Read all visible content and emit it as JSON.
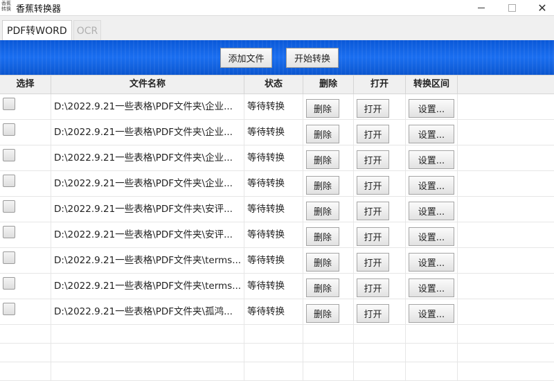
{
  "window": {
    "title": "香蕉转换器",
    "icon_text": "香蕉转换"
  },
  "tabs": [
    {
      "label": "PDF转WORD",
      "active": true
    },
    {
      "label": "OCR",
      "active": false
    }
  ],
  "toolbar": {
    "add_label": "添加文件",
    "start_label": "开始转换"
  },
  "table": {
    "headers": [
      "选择",
      "文件名称",
      "状态",
      "删除",
      "打开",
      "转换区间"
    ],
    "rows": [
      {
        "file": "D:\\2022.9.21一些表格\\PDF文件夹\\企业...",
        "status": "等待转换",
        "delete": "删除",
        "open": "打开",
        "range": "设置..."
      },
      {
        "file": "D:\\2022.9.21一些表格\\PDF文件夹\\企业...",
        "status": "等待转换",
        "delete": "删除",
        "open": "打开",
        "range": "设置..."
      },
      {
        "file": "D:\\2022.9.21一些表格\\PDF文件夹\\企业...",
        "status": "等待转换",
        "delete": "删除",
        "open": "打开",
        "range": "设置..."
      },
      {
        "file": "D:\\2022.9.21一些表格\\PDF文件夹\\企业...",
        "status": "等待转换",
        "delete": "删除",
        "open": "打开",
        "range": "设置..."
      },
      {
        "file": "D:\\2022.9.21一些表格\\PDF文件夹\\安评...",
        "status": "等待转换",
        "delete": "删除",
        "open": "打开",
        "range": "设置..."
      },
      {
        "file": "D:\\2022.9.21一些表格\\PDF文件夹\\安评...",
        "status": "等待转换",
        "delete": "删除",
        "open": "打开",
        "range": "设置..."
      },
      {
        "file": "D:\\2022.9.21一些表格\\PDF文件夹\\terms...",
        "status": "等待转换",
        "delete": "删除",
        "open": "打开",
        "range": "设置..."
      },
      {
        "file": "D:\\2022.9.21一些表格\\PDF文件夹\\terms...",
        "status": "等待转换",
        "delete": "删除",
        "open": "打开",
        "range": "设置..."
      },
      {
        "file": "D:\\2022.9.21一些表格\\PDF文件夹\\孤鸿...",
        "status": "等待转换",
        "delete": "删除",
        "open": "打开",
        "range": "设置..."
      }
    ],
    "empty_rows": 3
  },
  "colors": {
    "banner": "#0b5ad6",
    "header_bg": "#f0f0f0"
  }
}
